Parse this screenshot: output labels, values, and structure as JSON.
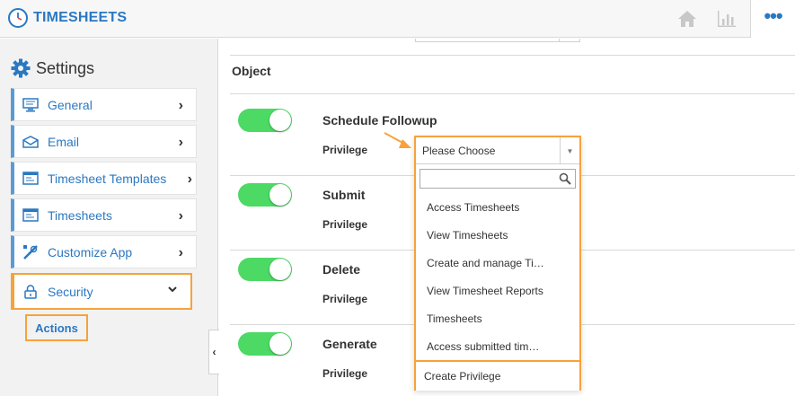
{
  "app": {
    "title": "TIMESHEETS"
  },
  "topbar": {
    "icons": [
      "home-icon",
      "bar-chart-icon",
      "more-icon"
    ],
    "more_label": "•••"
  },
  "sidebar": {
    "heading": "Settings",
    "items": [
      {
        "label": "General",
        "icon": "monitor-icon"
      },
      {
        "label": "Email",
        "icon": "envelope-icon"
      },
      {
        "label": "Timesheet Templates",
        "icon": "template-icon"
      },
      {
        "label": "Timesheets",
        "icon": "timesheet-icon"
      },
      {
        "label": "Customize App",
        "icon": "tools-icon"
      },
      {
        "label": "Security",
        "icon": "lock-icon",
        "expanded": true
      }
    ],
    "sub_items": [
      {
        "label": "Actions"
      }
    ],
    "chevron_right": "›",
    "chevron_down": "⌄",
    "collapse_glyph": "‹"
  },
  "main": {
    "section_label": "Object",
    "permissions": [
      {
        "name": "Schedule Followup",
        "privilege_label": "Privilege",
        "enabled": true
      },
      {
        "name": "Submit",
        "privilege_label": "Privilege",
        "enabled": true
      },
      {
        "name": "Delete",
        "privilege_label": "Privilege",
        "enabled": true
      },
      {
        "name": "Generate",
        "privilege_label": "Privilege",
        "enabled": true
      }
    ]
  },
  "dropdown": {
    "selected": "Please Choose",
    "search_value": "",
    "options": [
      "Access Timesheets",
      "View Timesheets",
      "Create and manage Ti…",
      "View Timesheet Reports",
      "Timesheets",
      "Access submitted tim…"
    ],
    "create_label": "Create Privilege"
  },
  "colors": {
    "accent": "#2b78c2",
    "highlight": "#f7a23b",
    "toggle_on": "#4cd964",
    "sidebar_bg": "#f2f2f2"
  }
}
